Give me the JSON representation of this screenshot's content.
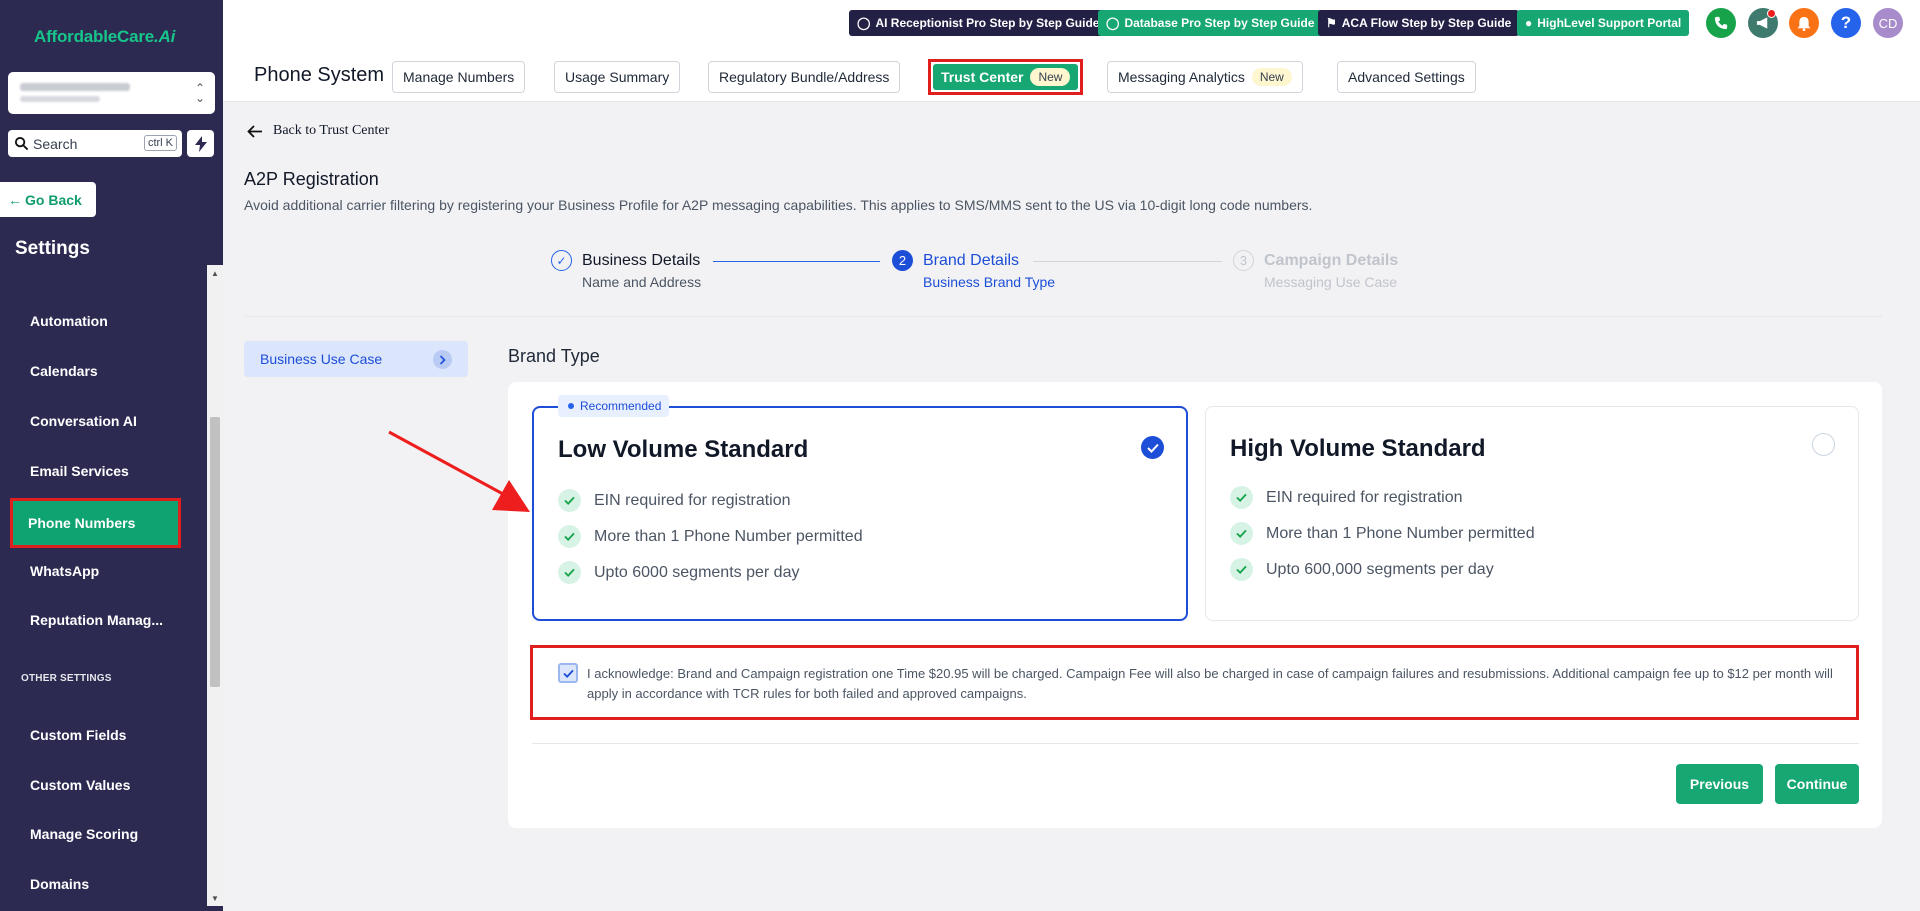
{
  "sidebar": {
    "logo": {
      "main": "AffordableCare",
      "suffix": ".Ai"
    },
    "search": {
      "placeholder": "Search",
      "shortcut": "ctrl K"
    },
    "go_back": "Go Back",
    "settings_title": "Settings",
    "items": [
      {
        "label": "Automation"
      },
      {
        "label": "Calendars"
      },
      {
        "label": "Conversation AI"
      },
      {
        "label": "Email Services"
      },
      {
        "label": "Phone Numbers",
        "active": true
      },
      {
        "label": "WhatsApp"
      },
      {
        "label": "Reputation Manag..."
      },
      {
        "label": "Custom Fields"
      },
      {
        "label": "Custom Values"
      },
      {
        "label": "Manage Scoring"
      },
      {
        "label": "Domains"
      }
    ],
    "section_other": "OTHER SETTINGS"
  },
  "topbar": {
    "buttons": [
      {
        "label": "AI Receptionist Pro Step by Step Guide",
        "icon": "chat-icon",
        "style": "dark"
      },
      {
        "label": "Database Pro Step by Step Guide",
        "icon": "chat-icon",
        "style": "green"
      },
      {
        "label": "ACA Flow Step by Step Guide",
        "icon": "tag-icon",
        "style": "dark"
      },
      {
        "label": "HighLevel Support Portal",
        "icon": "user-icon",
        "style": "green"
      }
    ],
    "avatar_initials": "CD",
    "colors": {
      "phone": "#17a34a",
      "megaphone": "#3f7a6e",
      "bell": "#f97316",
      "help": "#2563eb",
      "avatar": "#a78bca"
    }
  },
  "tabs": {
    "page_title": "Phone System",
    "items": [
      {
        "label": "Manage Numbers"
      },
      {
        "label": "Usage Summary"
      },
      {
        "label": "Regulatory Bundle/Address"
      },
      {
        "label": "Trust Center",
        "badge": "New",
        "active": true
      },
      {
        "label": "Messaging Analytics",
        "badge": "New"
      },
      {
        "label": "Advanced Settings"
      }
    ]
  },
  "main": {
    "back_label": "Back to Trust Center",
    "title": "A2P Registration",
    "subtitle": "Avoid additional carrier filtering by registering your Business Profile for A2P messaging capabilities. This applies to SMS/MMS sent to the US via 10-digit long code numbers.",
    "steps": [
      {
        "number": "1",
        "title": "Business Details",
        "sub": "Name and Address",
        "state": "done"
      },
      {
        "number": "2",
        "title": "Brand Details",
        "sub": "Business Brand Type",
        "state": "current"
      },
      {
        "number": "3",
        "title": "Campaign Details",
        "sub": "Messaging Use Case",
        "state": "todo"
      }
    ],
    "use_case_label": "Business Use Case",
    "brand_type_label": "Brand Type",
    "options": [
      {
        "title": "Low Volume Standard",
        "recommended": "Recommended",
        "selected": true,
        "features": [
          "EIN required for registration",
          "More than 1 Phone Number permitted",
          "Upto 6000 segments per day"
        ]
      },
      {
        "title": "High Volume Standard",
        "selected": false,
        "features": [
          "EIN required for registration",
          "More than 1 Phone Number permitted",
          "Upto 600,000 segments per day"
        ]
      }
    ],
    "acknowledge": {
      "checked": true,
      "text": "I acknowledge: Brand and Campaign registration one Time $20.95 will be charged. Campaign Fee will also be charged in case of campaign failures and resubmissions. Additional campaign fee up to $12 per month will apply in accordance with TCR rules for both failed and approved campaigns."
    },
    "previous_label": "Previous",
    "continue_label": "Continue"
  }
}
